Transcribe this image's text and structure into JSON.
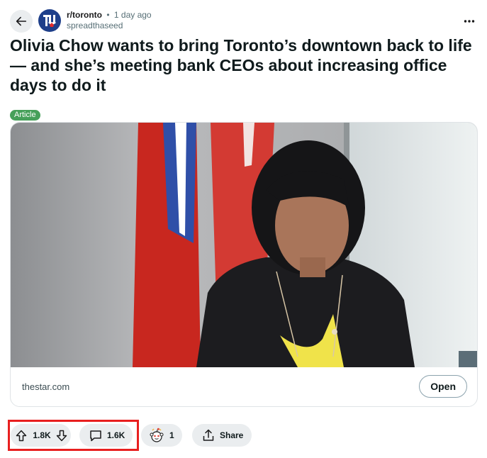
{
  "post": {
    "subreddit": "r/toronto",
    "separator": "•",
    "time": "1 day ago",
    "author": "spreadthaseed",
    "title": "Olivia Chow wants to bring Toronto’s downtown back to life — and she’s meeting bank CEOs about increasing office days to do it",
    "flair": "Article"
  },
  "link_card": {
    "domain": "thestar.com",
    "open_label": "Open"
  },
  "actions": {
    "vote_count": "1.8K",
    "comment_count": "1.6K",
    "award_count": "1",
    "share_label": "Share"
  },
  "icons": {
    "back": "arrow-left-icon",
    "more": "ellipsis-horizontal-icon",
    "upvote": "arrow-up-icon",
    "downvote": "arrow-down-icon",
    "comment": "speech-bubble-icon",
    "award": "snoo-award-icon",
    "share": "share-upload-icon"
  },
  "colors": {
    "flair": "#46a05a",
    "pill_bg": "#eaedef",
    "highlight": "#e81f1f",
    "subreddit_icon": "#1e3f8a"
  }
}
